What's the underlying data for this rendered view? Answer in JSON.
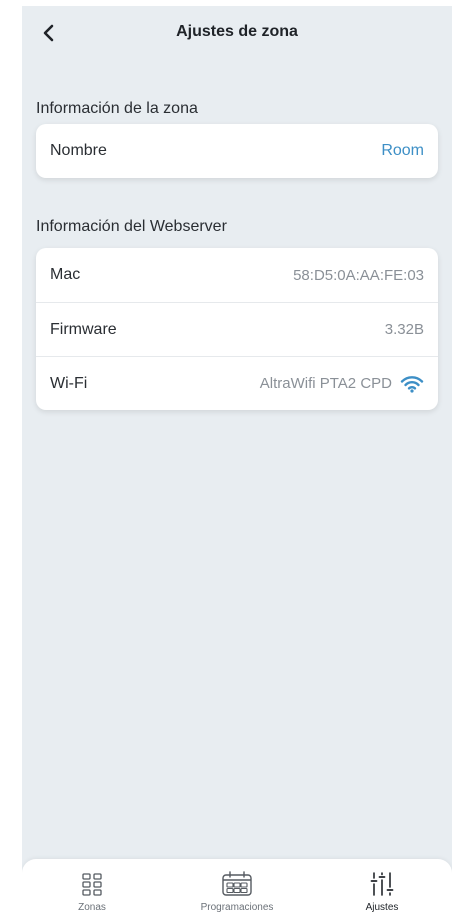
{
  "header": {
    "title": "Ajustes de zona",
    "back_icon": "chevron-left-icon"
  },
  "zone_info": {
    "section_title": "Información de la zona",
    "rows": [
      {
        "label": "Nombre",
        "value": "Room"
      }
    ]
  },
  "webserver_info": {
    "section_title": "Información del Webserver",
    "rows": [
      {
        "label": "Mac",
        "value": "58:D5:0A:AA:FE:03"
      },
      {
        "label": "Firmware",
        "value": "3.32B"
      },
      {
        "label": "Wi-Fi",
        "value": "AltraWifi PTA2 CPD",
        "icon": "wifi-icon"
      }
    ]
  },
  "tabbar": {
    "tabs": [
      {
        "label": "Zonas",
        "icon": "grid-icon"
      },
      {
        "label": "Programaciones",
        "icon": "calendar-icon"
      },
      {
        "label": "Ajustes",
        "icon": "sliders-icon",
        "active": true
      }
    ]
  },
  "colors": {
    "background": "#e8edf1",
    "accent": "#3d8fc6",
    "text": "#2a2e33",
    "muted": "#8a9097"
  }
}
